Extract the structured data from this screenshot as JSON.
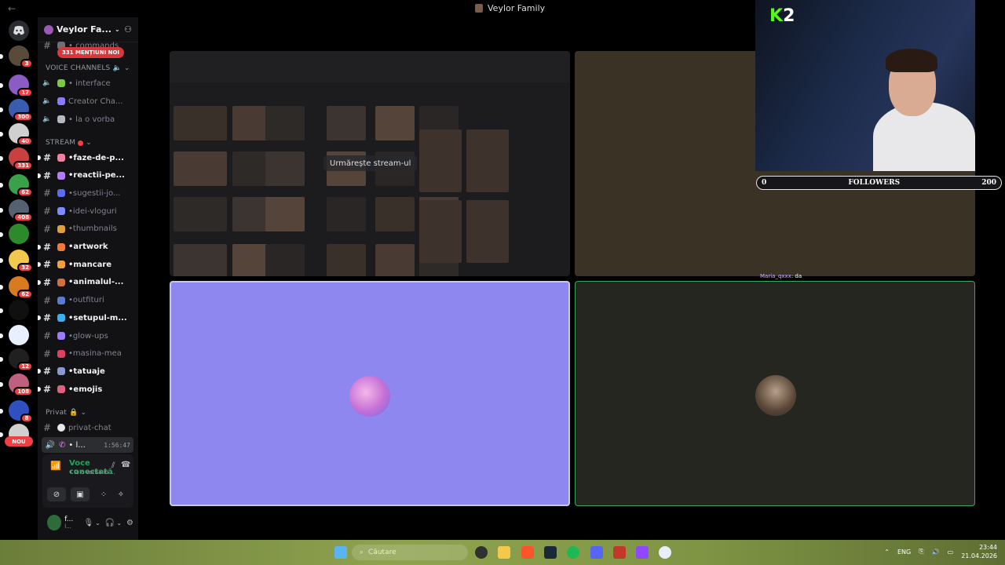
{
  "window": {
    "nav_back": "←",
    "nav_forward": "→",
    "title": "Veylor Family"
  },
  "rail": {
    "discord_icon": "discord-icon",
    "servers": [
      {
        "badge": "3",
        "color": "#5a4a3a"
      },
      {
        "badge": "17",
        "color": "#8a5cc4"
      },
      {
        "badge": "300",
        "color": "#3a5cae"
      },
      {
        "badge": "40",
        "color": "#d0d0d0"
      },
      {
        "badge": "331",
        "color": "#c94040"
      },
      {
        "badge": "62",
        "color": "#3aa04a"
      },
      {
        "badge": "408",
        "color": "#556070"
      },
      {
        "badge": "",
        "color": "#2c8a2c"
      },
      {
        "badge": "32",
        "color": "#f2c94c"
      },
      {
        "badge": "62",
        "color": "#d87a20"
      },
      {
        "badge": "",
        "color": "#101010"
      },
      {
        "badge": "",
        "color": "#e8f0ff"
      },
      {
        "badge": "12",
        "color": "#202020"
      },
      {
        "badge": "108",
        "color": "#c06080"
      },
      {
        "badge": "8",
        "color": "#3050c0"
      },
      {
        "badge": "",
        "color": "#d0d0d0"
      }
    ],
    "nou_badge": "NOU"
  },
  "sidebar": {
    "server_name": "Veylor Fa...",
    "mentions_badge": "331 MENȚIUNI NOI",
    "top_channel": "• commands",
    "voice_category": "VOICE CHANNELS",
    "voice_channels": [
      {
        "name": "• interface"
      },
      {
        "name": "Creator Cha..."
      },
      {
        "name": "• la o vorba"
      }
    ],
    "stream_category": "STREAM",
    "stream_channels": [
      {
        "name": "faze-de-p...",
        "unread": true
      },
      {
        "name": "reactii-pe...",
        "unread": true
      },
      {
        "name": "sugestii-jo...",
        "unread": false
      },
      {
        "name": "idei-vloguri",
        "unread": false
      },
      {
        "name": "thumbnails",
        "unread": false
      },
      {
        "name": "artwork",
        "unread": true
      },
      {
        "name": "mancare",
        "unread": true
      },
      {
        "name": "animalul-...",
        "unread": true
      },
      {
        "name": "outfituri",
        "unread": false
      },
      {
        "name": "setupul-m...",
        "unread": true
      },
      {
        "name": "glow-ups",
        "unread": false
      },
      {
        "name": "masina-mea",
        "unread": false
      },
      {
        "name": "tatuaje",
        "unread": true
      },
      {
        "name": "emojis",
        "unread": true
      }
    ],
    "private_category": "Privat",
    "private_channels": [
      {
        "name": "privat-chat"
      }
    ],
    "active_voice": {
      "name": "• l...",
      "time": "1:56:47"
    },
    "voice_panel": {
      "status": "Voce conectată",
      "sub": "• la o vorba in ..."
    },
    "user": {
      "name": "f...",
      "sub": "l..."
    }
  },
  "stage": {
    "watch_stream": "Urmărește stream-ul"
  },
  "overlay": {
    "kick_k": "K",
    "kick_num": "2",
    "followers_min": "0",
    "followers_label": "FOLLOWERS",
    "followers_max": "200",
    "chat_user": "Maria_qxxx",
    "chat_msg": ": da"
  },
  "taskbar": {
    "search_placeholder": "Căutare",
    "lang": "ENG",
    "time": "23:44",
    "date": "21.04.2026"
  }
}
